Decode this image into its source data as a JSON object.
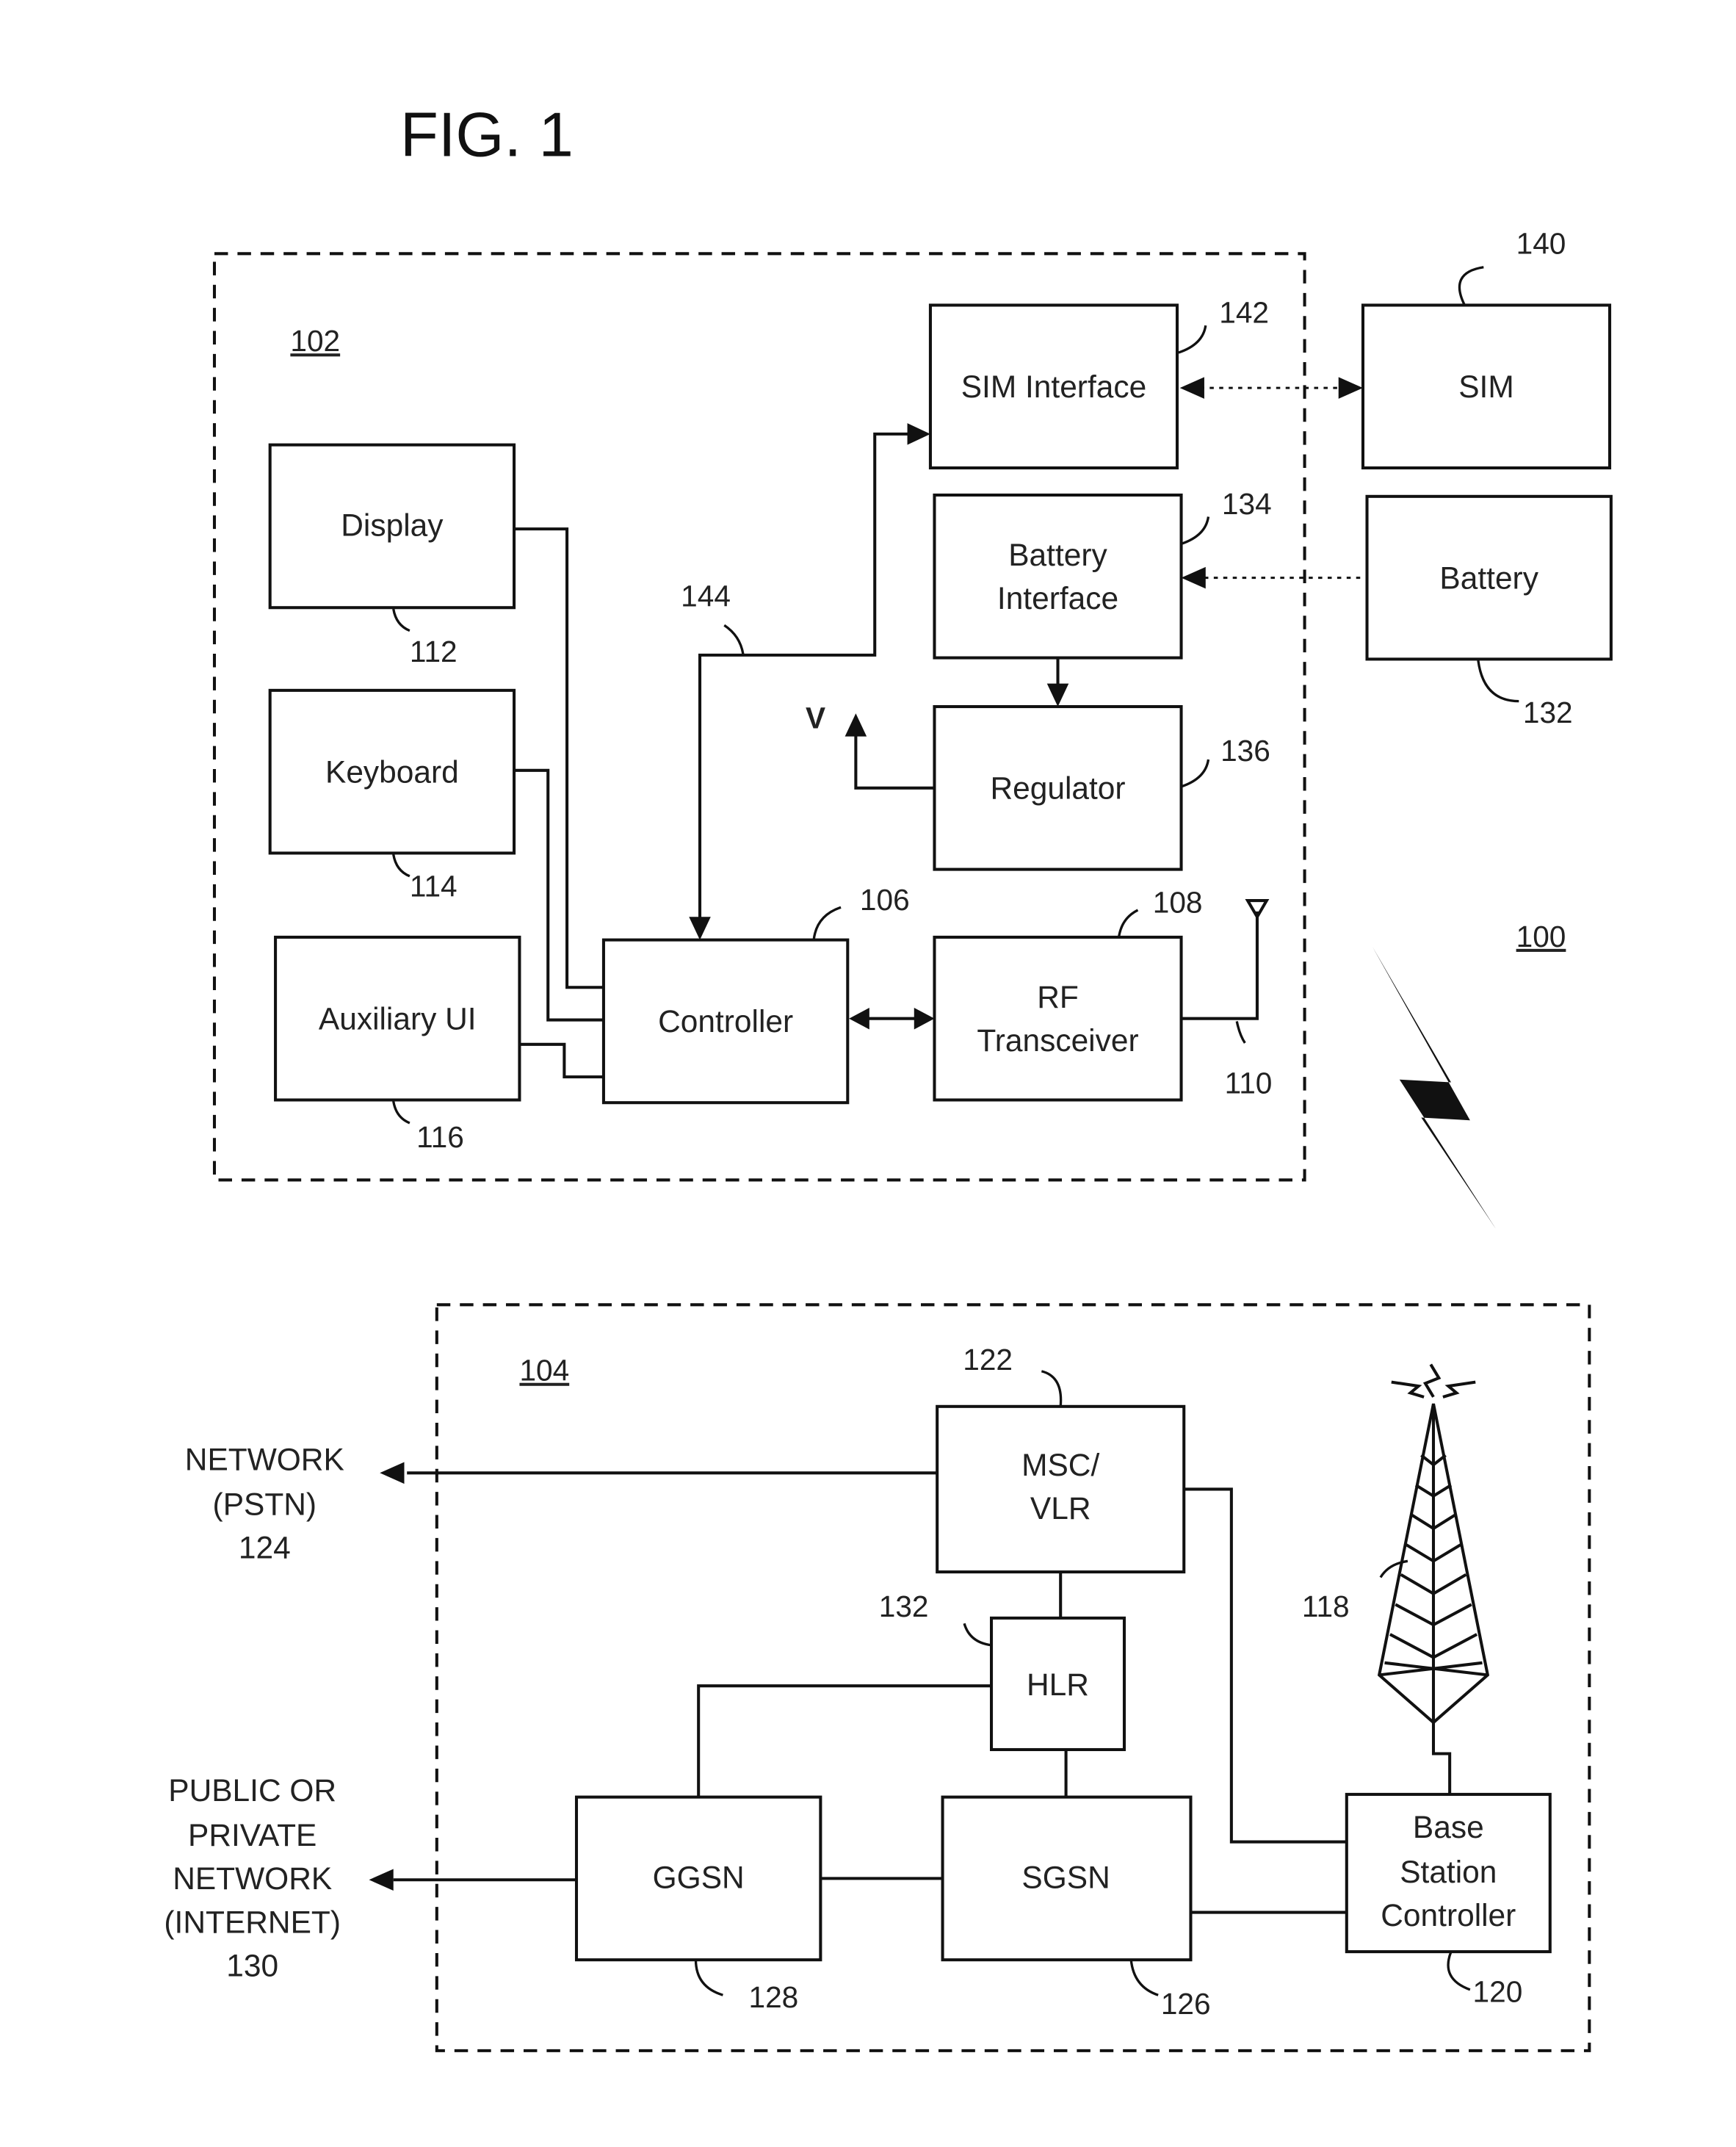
{
  "figure": {
    "title": "FIG. 1",
    "system_ref": "100"
  },
  "device": {
    "ref": "102",
    "blocks": {
      "display": {
        "label": "Display",
        "ref": "112"
      },
      "keyboard": {
        "label": "Keyboard",
        "ref": "114"
      },
      "auxiliary_ui": {
        "label": "Auxiliary UI",
        "ref": "116"
      },
      "controller": {
        "label": "Controller",
        "ref": "106"
      },
      "rf_transceiver": {
        "label_line1": "RF",
        "label_line2": "Transceiver",
        "ref": "108"
      },
      "sim_interface": {
        "label": "SIM Interface",
        "ref": "142"
      },
      "battery_interface": {
        "label_line1": "Battery",
        "label_line2": "Interface",
        "ref": "134"
      },
      "regulator": {
        "label": "Regulator",
        "ref": "136"
      }
    },
    "bus_ref": "144",
    "antenna_ref": "110",
    "voltage_label": "V"
  },
  "external": {
    "sim": {
      "label": "SIM",
      "ref": "140"
    },
    "battery": {
      "label": "Battery",
      "ref": "132"
    }
  },
  "network": {
    "ref": "104",
    "blocks": {
      "msc_vlr": {
        "label_line1": "MSC/",
        "label_line2": "VLR",
        "ref": "122"
      },
      "hlr": {
        "label": "HLR",
        "ref": "132"
      },
      "ggsn": {
        "label": "GGSN",
        "ref": "128"
      },
      "sgsn": {
        "label": "SGSN",
        "ref": "126"
      },
      "bsc": {
        "label_line1": "Base",
        "label_line2": "Station",
        "label_line3": "Controller",
        "ref": "120"
      }
    },
    "tower_ref": "118",
    "pstn": {
      "line1": "NETWORK",
      "line2": "(PSTN)",
      "ref": "124"
    },
    "internet": {
      "line1": "PUBLIC OR",
      "line2": "PRIVATE",
      "line3": "NETWORK",
      "line4": "(INTERNET)",
      "ref": "130"
    }
  }
}
